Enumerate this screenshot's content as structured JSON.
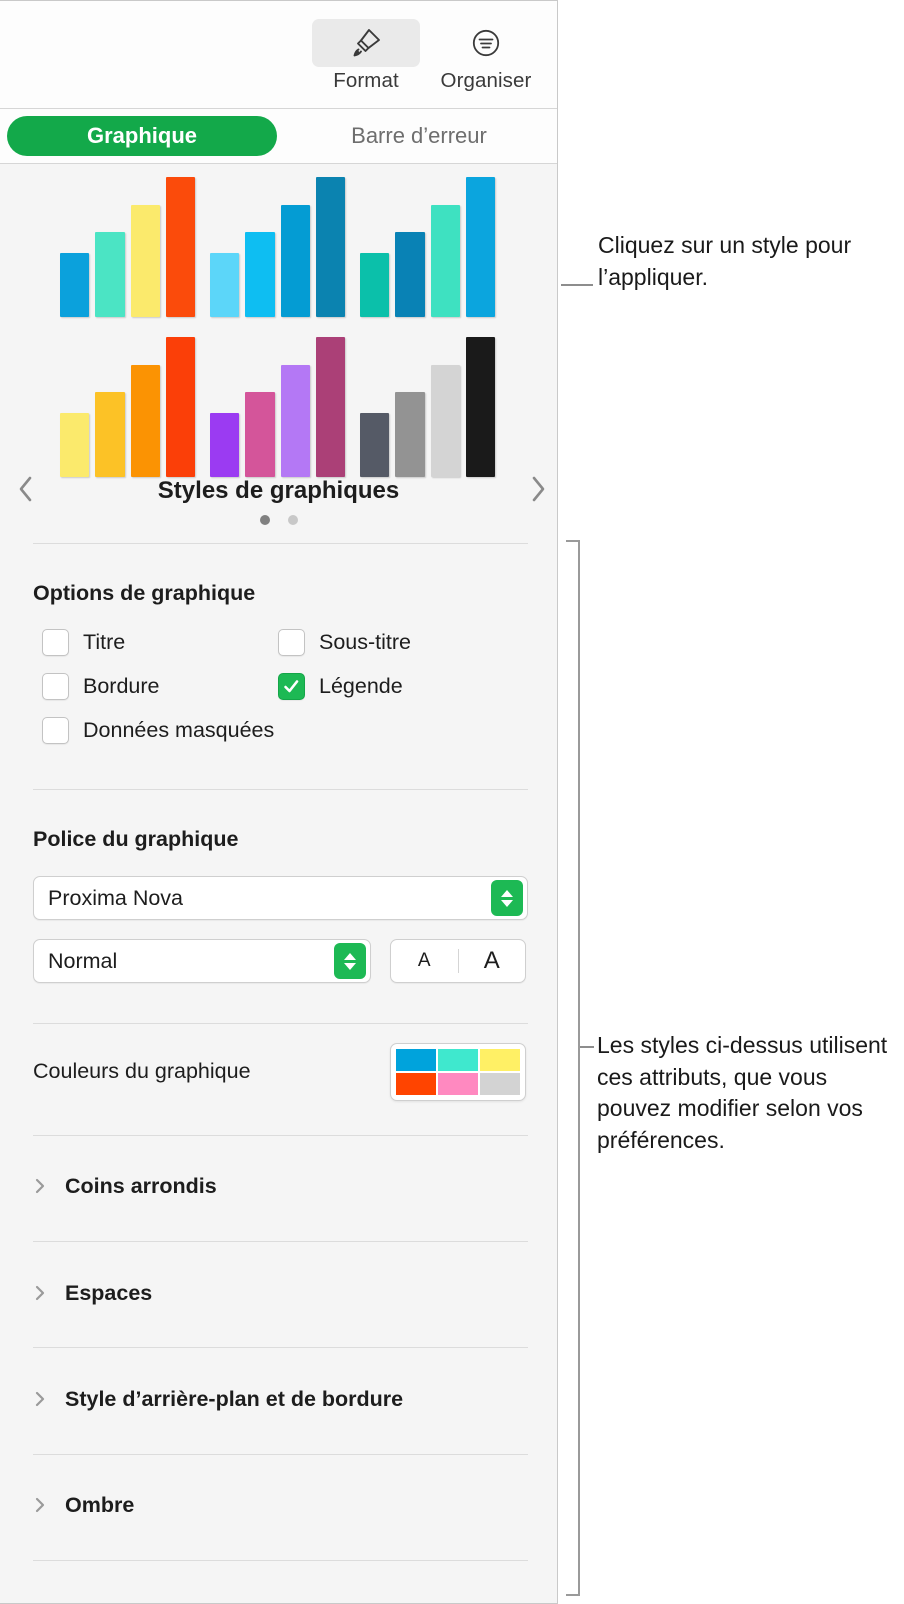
{
  "toolbar": {
    "format_label": "Format",
    "organiser_label": "Organiser",
    "format_icon": "paintbrush-icon",
    "organiser_icon": "arrange-icon"
  },
  "tabs": {
    "selected": "Graphique",
    "unselected": "Barre d’erreur"
  },
  "gallery": {
    "title": "Styles de graphiques",
    "prev_icon": "chevron-left-icon",
    "next_icon": "chevron-right-icon",
    "page_dots": [
      {
        "active": true,
        "color": "#808080"
      },
      {
        "active": false,
        "color": "#c8c8c8"
      }
    ],
    "styles": [
      {
        "name": "style-1",
        "heights": [
          46,
          61,
          80,
          100
        ],
        "colors": [
          "#0BA1DC",
          "#4BE4C4",
          "#FBEA6C",
          "#FB4B0B"
        ]
      },
      {
        "name": "style-2",
        "heights": [
          46,
          61,
          80,
          100
        ],
        "colors": [
          "#5CD6F9",
          "#0EBEF2",
          "#049CD3",
          "#0B83B0"
        ]
      },
      {
        "name": "style-3",
        "heights": [
          46,
          61,
          80,
          100
        ],
        "colors": [
          "#0BC0AA",
          "#0982B5",
          "#3EE1C1",
          "#0BA5DE"
        ]
      },
      {
        "name": "style-4",
        "heights": [
          46,
          61,
          80,
          100
        ],
        "colors": [
          "#FBEA6C",
          "#FCC226",
          "#FB9303",
          "#FB3F08"
        ]
      },
      {
        "name": "style-5",
        "heights": [
          46,
          61,
          80,
          100
        ],
        "colors": [
          "#9B3BF2",
          "#D4559A",
          "#B478F5",
          "#AB4077"
        ]
      },
      {
        "name": "style-6",
        "heights": [
          46,
          61,
          80,
          100
        ],
        "colors": [
          "#555A66",
          "#939393",
          "#D4D4D4",
          "#1A1A1A"
        ]
      }
    ]
  },
  "chart_options": {
    "heading": "Options de graphique",
    "items": [
      {
        "label": "Titre",
        "checked": false
      },
      {
        "label": "Sous-titre",
        "checked": false
      },
      {
        "label": "Bordure",
        "checked": false
      },
      {
        "label": "Légende",
        "checked": true
      },
      {
        "label": "Données masquées",
        "checked": false
      }
    ]
  },
  "chart_font": {
    "heading": "Police du graphique",
    "family_value": "Proxima Nova",
    "style_value": "Normal",
    "size_decrease_label": "A",
    "size_increase_label": "A"
  },
  "chart_colors": {
    "label": "Couleurs du graphique",
    "swatches": [
      "#00A3DC",
      "#3FE8CE",
      "#FFF065",
      "#FF4400",
      "#FF89C0",
      "#D3D3D3"
    ]
  },
  "sections": [
    {
      "label": "Coins arrondis",
      "icon": "chevron-right-icon"
    },
    {
      "label": "Espaces",
      "icon": "chevron-right-icon"
    },
    {
      "label": "Style d’arrière-plan et de bordure",
      "icon": "chevron-right-icon"
    },
    {
      "label": "Ombre",
      "icon": "chevron-right-icon"
    }
  ],
  "callouts": {
    "top": "Cliquez sur un style pour l’appliquer.",
    "bottom": "Les styles ci-dessus utilisent ces attributs, que vous pouvez modifier selon vos préférences."
  }
}
